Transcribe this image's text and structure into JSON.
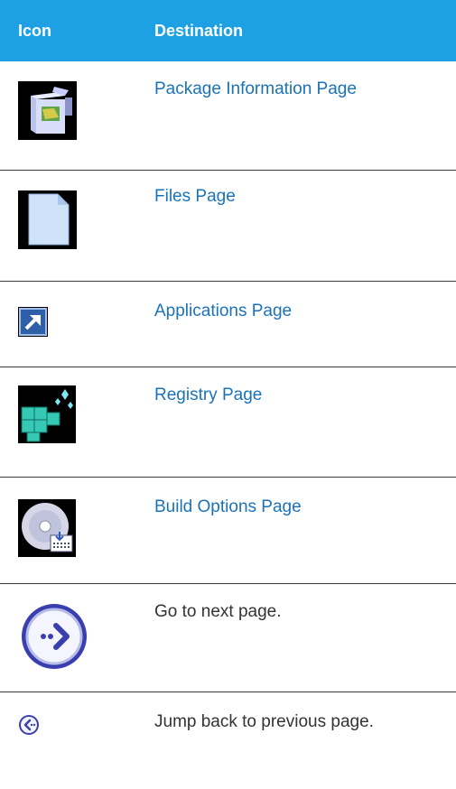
{
  "table": {
    "header": {
      "icon": "Icon",
      "destination": "Destination"
    },
    "rows": [
      {
        "icon": "package-icon",
        "destination": "Package Information Page",
        "is_link": true
      },
      {
        "icon": "file-icon",
        "destination": "Files Page",
        "is_link": true
      },
      {
        "icon": "shortcut-arrow-icon",
        "destination": "Applications Page",
        "is_link": true
      },
      {
        "icon": "registry-cubes-icon",
        "destination": "Registry Page",
        "is_link": true
      },
      {
        "icon": "build-disc-icon",
        "destination": "Build Options Page",
        "is_link": true
      },
      {
        "icon": "next-page-icon",
        "destination": "Go to next page.",
        "is_link": false
      },
      {
        "icon": "previous-page-icon",
        "destination": "Jump back to previous page.",
        "is_link": false
      }
    ]
  },
  "colors": {
    "header_bg": "#1da1e4",
    "link": "#1a73b8",
    "text": "#333333",
    "rule": "#3a3a3a"
  }
}
